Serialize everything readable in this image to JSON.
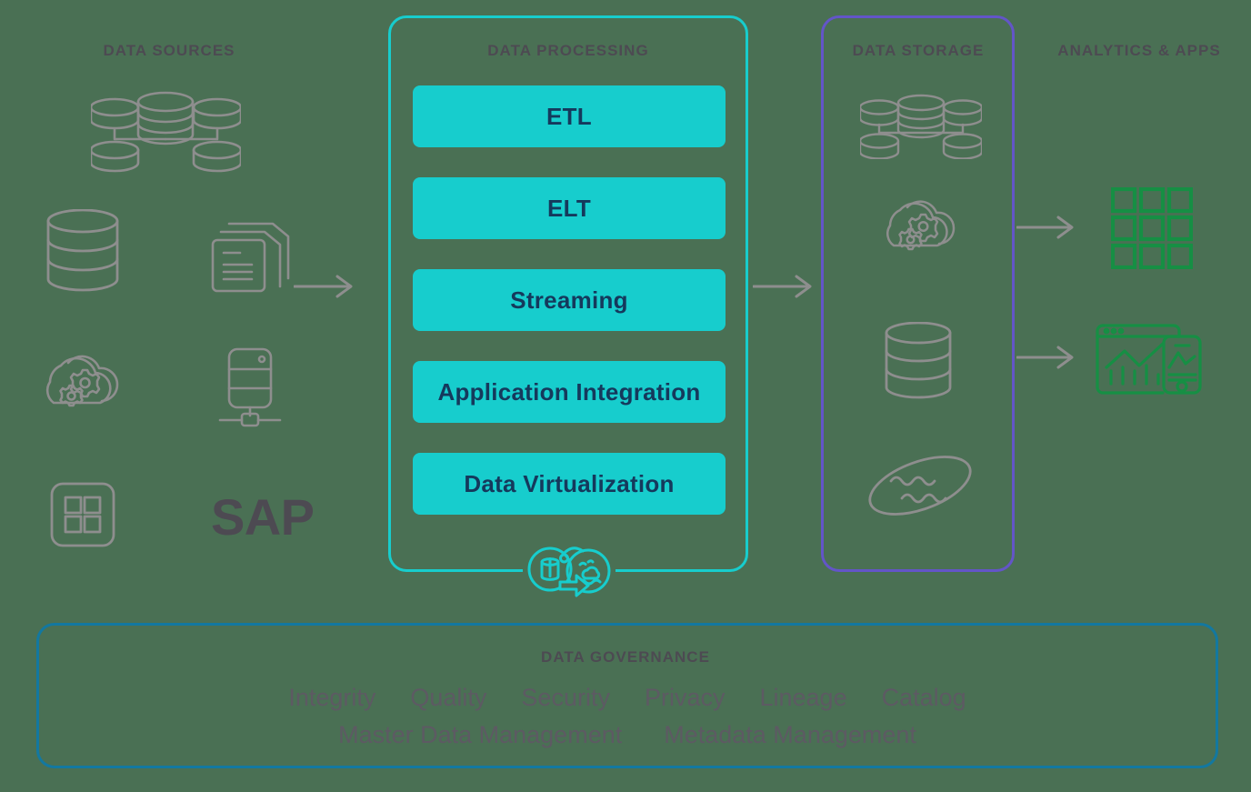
{
  "columns": {
    "data_sources": {
      "title": "DATA SOURCES"
    },
    "data_processing": {
      "title": "DATA PROCESSING"
    },
    "data_storage": {
      "title": "DATA STORAGE"
    },
    "analytics_apps": {
      "title": "ANALYTICS & APPS"
    }
  },
  "processing": {
    "chips": [
      {
        "label": "ETL"
      },
      {
        "label": "ELT"
      },
      {
        "label": "Streaming"
      },
      {
        "label": "Application Integration"
      },
      {
        "label": "Data Virtualization"
      }
    ]
  },
  "data_sources": {
    "icons": [
      {
        "name": "distributed-databases-icon"
      },
      {
        "name": "database-icon"
      },
      {
        "name": "documents-icon"
      },
      {
        "name": "cloud-services-icon"
      },
      {
        "name": "server-icon"
      },
      {
        "name": "applications-grid-icon"
      }
    ],
    "sap_logo": "SAP"
  },
  "data_storage": {
    "icons": [
      {
        "name": "distributed-databases-icon"
      },
      {
        "name": "cloud-services-icon"
      },
      {
        "name": "database-icon"
      },
      {
        "name": "data-lake-icon"
      }
    ]
  },
  "analytics": {
    "icons": [
      {
        "name": "application-grid-icon"
      },
      {
        "name": "dashboard-analytics-icon"
      }
    ]
  },
  "hybrid_icon": {
    "name": "data-migration-hybrid-icon"
  },
  "governance": {
    "title": "DATA GOVERNANCE",
    "row1": [
      "Integrity",
      "Quality",
      "Security",
      "Privacy",
      "Lineage",
      "Catalog"
    ],
    "row2": [
      "Master Data Management",
      "Metadata Management"
    ]
  },
  "arrows": [
    {
      "name": "arrow-sources-to-processing"
    },
    {
      "name": "arrow-processing-to-storage"
    },
    {
      "name": "arrow-storage-to-apps-grid"
    },
    {
      "name": "arrow-storage-to-apps-dashboard"
    }
  ],
  "colors": {
    "background": "#4a7054",
    "teal": "#17cdcd",
    "purple": "#6355c8",
    "blue": "#1378a0",
    "green": "#168f44",
    "gray_icon": "#8e8e8e",
    "heading": "#4d4a52",
    "chip_text": "#15395c"
  }
}
